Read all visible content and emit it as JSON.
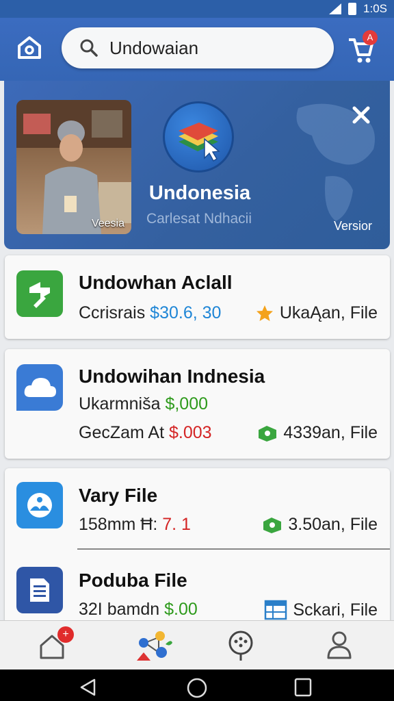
{
  "status_bar": {
    "time": "1:0S"
  },
  "header": {
    "search_value": "Undowaian",
    "cart_badge": "A"
  },
  "banner": {
    "photo_caption": "Veesia",
    "title": "Undonesia",
    "subtitle": "Carlesat Ndhacii",
    "version_label": "Versior"
  },
  "cards": [
    {
      "title": "Undowhan Aclall",
      "line1_label": "Ccrisrais",
      "line1_value": "$30.6, 30",
      "right1_text": "UkaĄan, File",
      "icon": "green-refresh-icon"
    },
    {
      "title": "Undowihan Indnesia",
      "line1_label": "Ukarmniša",
      "line1_value": "$,000",
      "line2_label": "GecZam At",
      "line2_value": "$.003",
      "right2_text": "4339an, File",
      "icon": "cloud-icon"
    },
    {
      "title": "Vary File",
      "line1_label": "158mm Ħ:",
      "line1_value": "7. 1",
      "right1_text": "3.50an, File",
      "icon": "globe-icon"
    },
    {
      "title": "Poduba File",
      "line1_label": "32I bamdn",
      "line1_value": "$.00",
      "right1_text": "Sckari, File",
      "icon": "document-icon"
    }
  ],
  "bottom_nav": {
    "home_badge": "+"
  },
  "colors": {
    "header_blue": "#3566b5",
    "price_blue": "#1f86d6",
    "price_green": "#2e9a1c",
    "price_red": "#d42424",
    "badge_red": "#e02b2b"
  }
}
